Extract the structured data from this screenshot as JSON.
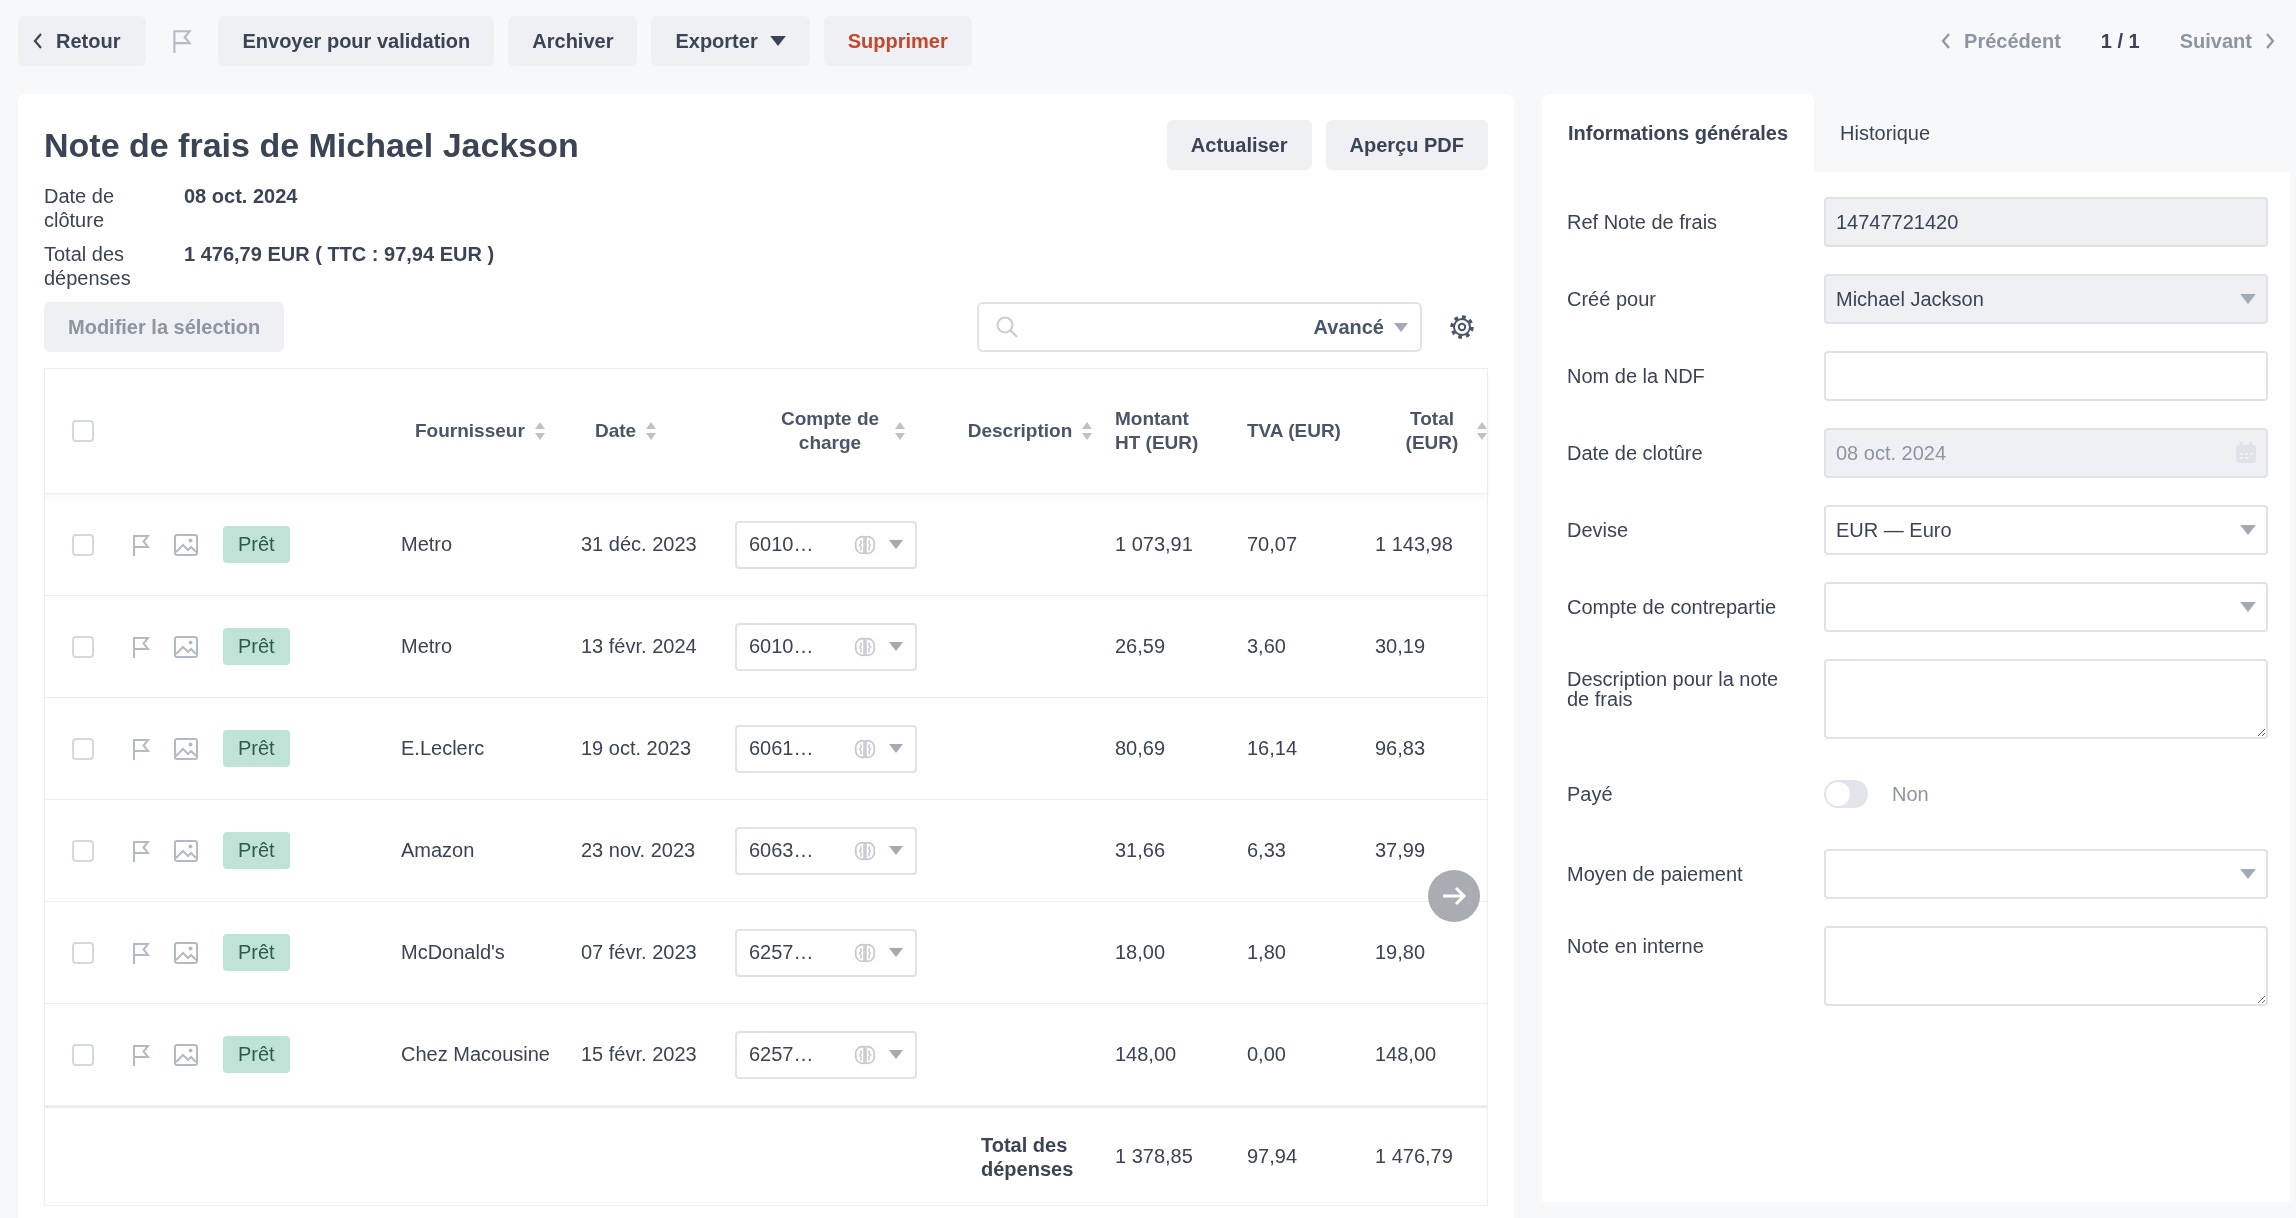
{
  "toolbar": {
    "back": "Retour",
    "buttons": [
      {
        "label": "Envoyer pour validation",
        "kind": "plain"
      },
      {
        "label": "Archiver",
        "kind": "plain"
      },
      {
        "label": "Exporter",
        "kind": "dropdown"
      },
      {
        "label": "Supprimer",
        "kind": "danger"
      }
    ],
    "pager": {
      "previous": {
        "label": "Précédent",
        "disabled": true
      },
      "position": "1 / 1",
      "next": {
        "label": "Suivant",
        "disabled": true
      }
    }
  },
  "report": {
    "title": "Note de frais de Michael Jackson",
    "actions": [
      "Actualiser",
      "Aperçu PDF"
    ],
    "info": [
      {
        "label": "Date de clôture",
        "value": "08 oct. 2024"
      },
      {
        "label": "Total des dépenses",
        "value": "1 476,79 EUR ( TTC : 97,94 EUR )"
      }
    ],
    "bulk_button": {
      "label": "Modifier la sélection",
      "disabled": true
    },
    "search": {
      "filter_label": "Avancé"
    }
  },
  "table": {
    "all_selected": false,
    "columns": [
      {
        "label": "Fournisseur",
        "sortable": true
      },
      {
        "label": "Date",
        "sortable": true
      },
      {
        "label": "Compte de charge",
        "sortable": true
      },
      {
        "label": "Description",
        "sortable": true
      },
      {
        "label": "Montant HT (EUR)",
        "sortable": false
      },
      {
        "label": "TVA (EUR)",
        "sortable": false
      },
      {
        "label": "Total (EUR)",
        "sortable": true
      }
    ],
    "rows": [
      {
        "checked": false,
        "status": "Prêt",
        "supplier": "Metro",
        "date": "31 déc. 2023",
        "account": "6010…",
        "amount_ht": "1 073,91",
        "vat": "70,07",
        "total": "1 143,98"
      },
      {
        "checked": false,
        "status": "Prêt",
        "supplier": "Metro",
        "date": "13 févr. 2024",
        "account": "6010…",
        "amount_ht": "26,59",
        "vat": "3,60",
        "total": "30,19"
      },
      {
        "checked": false,
        "status": "Prêt",
        "supplier": "E.Leclerc",
        "date": "19 oct. 2023",
        "account": "6061…",
        "amount_ht": "80,69",
        "vat": "16,14",
        "total": "96,83"
      },
      {
        "checked": false,
        "status": "Prêt",
        "supplier": "Amazon",
        "date": "23 nov. 2023",
        "account": "6063…",
        "amount_ht": "31,66",
        "vat": "6,33",
        "total": "37,99"
      },
      {
        "checked": false,
        "status": "Prêt",
        "supplier": "McDonald's",
        "date": "07 févr. 2023",
        "account": "6257…",
        "amount_ht": "18,00",
        "vat": "1,80",
        "total": "19,80"
      },
      {
        "checked": false,
        "status": "Prêt",
        "supplier": "Chez Macousine",
        "date": "15 févr. 2023",
        "account": "6257…",
        "amount_ht": "148,00",
        "vat": "0,00",
        "total": "148,00"
      }
    ],
    "footer": {
      "label": "Total des dépenses",
      "amount_ht": "1 378,85",
      "vat": "97,94",
      "total": "1 476,79"
    }
  },
  "sidebar": {
    "tabs": [
      {
        "label": "Informations générales",
        "selected": true
      },
      {
        "label": "Historique",
        "selected": false
      }
    ],
    "fields": [
      {
        "label": "Ref Note de frais",
        "kind": "text",
        "value": "14747721420",
        "disabled": true
      },
      {
        "label": "Créé pour",
        "kind": "select",
        "value": "Michael Jackson",
        "disabled": true
      },
      {
        "label": "Nom de la NDF",
        "kind": "text",
        "disabled": false
      },
      {
        "label": "Date de clotûre",
        "kind": "date",
        "value": "08 oct. 2024",
        "disabled": true
      },
      {
        "label": "Devise",
        "kind": "select",
        "value": "EUR — Euro",
        "disabled": false
      },
      {
        "label": "Compte de contrepartie",
        "kind": "select",
        "disabled": false
      },
      {
        "label": "Description pour la note de frais",
        "kind": "textarea",
        "disabled": false
      },
      {
        "label": "Payé",
        "kind": "toggle",
        "on": false,
        "state_label": "Non"
      },
      {
        "label": "Moyen de paiement",
        "kind": "select",
        "disabled": false
      },
      {
        "label": "Note en interne",
        "kind": "textarea",
        "disabled": false
      }
    ]
  }
}
